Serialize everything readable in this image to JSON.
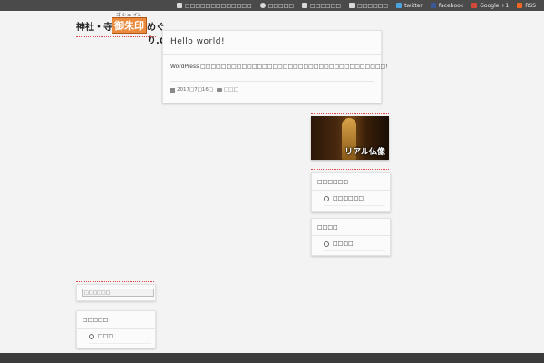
{
  "topbar": {
    "links": [
      {
        "label": "□□□□□□□□□□□□□",
        "icon": "edit-icon",
        "color": "#d9d9d9"
      },
      {
        "label": "□□□□□",
        "icon": "user-icon",
        "color": "#d9d9d9"
      },
      {
        "label": "□□□□□□",
        "icon": "page-icon",
        "color": "#d9d9d9"
      },
      {
        "label": "□□□□□□",
        "icon": "rss-page-icon",
        "color": "#d9d9d9"
      },
      {
        "label": "twitter",
        "icon": "twitter-icon",
        "color": "#4aa3df"
      },
      {
        "label": "facebook",
        "icon": "facebook-icon",
        "color": "#3b5998"
      },
      {
        "label": "Google +1",
        "icon": "google-plus-icon",
        "color": "#d34836"
      },
      {
        "label": "RSS",
        "icon": "rss-icon",
        "color": "#f26522"
      }
    ]
  },
  "logo": {
    "left": "神社・寺・",
    "mid": "御朱印",
    "ruby": "-ゴ-シュ-イン-",
    "right": "めぐり.COM"
  },
  "post": {
    "title": "Hello world!",
    "excerpt": "WordPress □□□□□□□□□□□□□□□□□□□□□□□□□□□□□□□□□□□□!",
    "date": "2017□7□16□",
    "category": "□□□"
  },
  "banner": {
    "text": "リアル仏像"
  },
  "widgets": {
    "right1": {
      "title": "□□□□□□",
      "item": "□□□□□□"
    },
    "right2": {
      "title": "□□□□",
      "item": "□□□□"
    },
    "left1": {
      "title": "□□□□□",
      "item": "□□□"
    }
  },
  "search": {
    "placeholder": "□□□□□□"
  }
}
